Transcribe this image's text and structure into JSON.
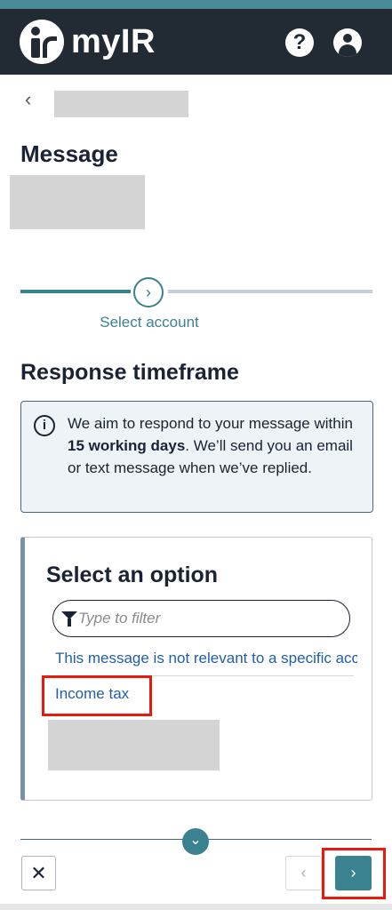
{
  "header": {
    "brand": "myIR",
    "help_glyph": "?",
    "colors": {
      "bar": "#222b33",
      "strip": "#4a8a96"
    }
  },
  "nav": {
    "back_glyph": "‹"
  },
  "page": {
    "title": "Message"
  },
  "progress": {
    "step_label": "Select account",
    "step_glyph": "›",
    "accent": "#3a8290"
  },
  "response": {
    "heading": "Response timeframe",
    "info_icon": "i",
    "text_before": "We aim to respond to your message within ",
    "text_bold": "15 working days",
    "text_after": ". We’ll send you an email or text message when we’ve replied."
  },
  "select": {
    "title": "Select an option",
    "filter_placeholder": "Type to filter",
    "options": [
      "This message is not relevant to a specific account",
      "Income tax"
    ]
  },
  "footer": {
    "expand_glyph": "⌄",
    "close_glyph": "✕",
    "prev_glyph": "‹",
    "next_glyph": "›"
  },
  "highlight_color": "#e81a10"
}
